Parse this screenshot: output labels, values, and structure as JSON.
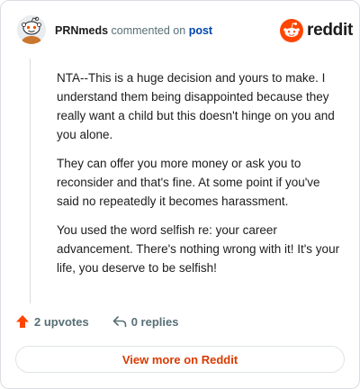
{
  "header": {
    "username": "PRNmeds",
    "action": "commented on",
    "target": "post"
  },
  "brand": {
    "name": "reddit",
    "color": "#ff4500"
  },
  "comment": {
    "paragraphs": [
      "NTA--This is a huge decision and yours to make. I understand them being disappointed because they really want a child but this doesn't hinge on you and you alone.",
      "They can offer you more money or ask you to reconsider and that's fine. At some point if you've said no repeatedly it becomes harassment.",
      "You used the word selfish re: your career advancement. There's nothing wrong with it! It's your life, you deserve to be selfish!"
    ]
  },
  "actions": {
    "upvotes": "2 upvotes",
    "replies": "0 replies",
    "upvote_icon": "upvote-arrow-icon",
    "reply_icon": "reply-arrow-icon"
  },
  "view_more": {
    "label": "View more on Reddit",
    "color": "#d93a00"
  },
  "avatar": {
    "icon": "snoo-avatar"
  }
}
